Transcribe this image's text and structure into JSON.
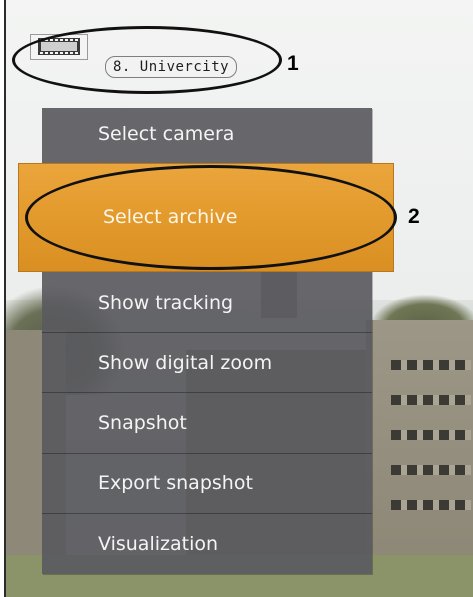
{
  "camera": {
    "name": "8. Univercity",
    "icon": "film-strip-icon"
  },
  "menu": {
    "items": [
      {
        "label": "Select camera"
      },
      {
        "label": "Select archive",
        "highlighted": true
      },
      {
        "label": "Show tracking"
      },
      {
        "label": "Show digital zoom"
      },
      {
        "label": "Snapshot"
      },
      {
        "label": "Export snapshot"
      },
      {
        "label": "Visualization"
      }
    ],
    "background": "#5a5a5f",
    "highlight_color": "#e39a2c"
  },
  "callouts": [
    {
      "number": "1"
    },
    {
      "number": "2"
    }
  ]
}
